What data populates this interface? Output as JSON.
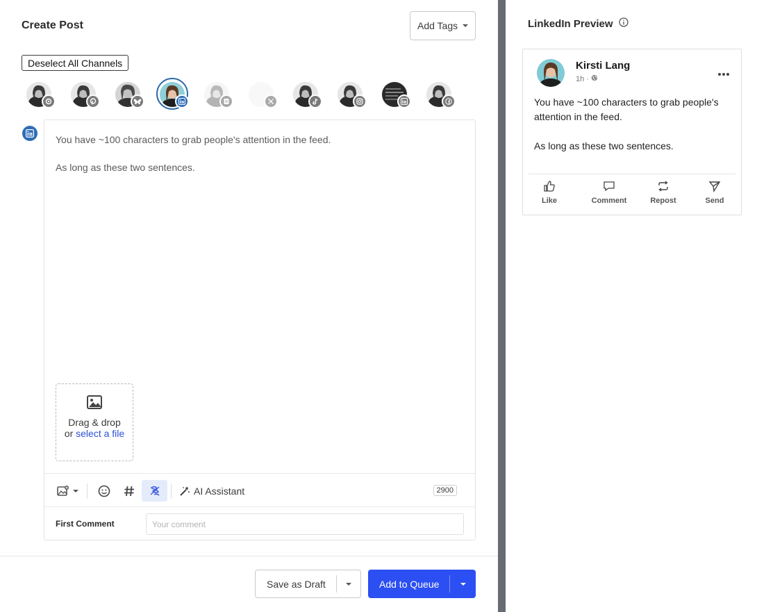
{
  "composer": {
    "title": "Create Post",
    "add_tags_label": "Add Tags",
    "deselect_label": "Deselect All Channels",
    "channels": [
      {
        "network": "threads",
        "icon": "threads-icon",
        "state": "normal"
      },
      {
        "network": "pinterest",
        "icon": "pinterest-icon",
        "state": "normal"
      },
      {
        "network": "bluesky",
        "icon": "butterfly-icon",
        "state": "normal"
      },
      {
        "network": "linkedin",
        "icon": "linkedin-icon",
        "state": "selected"
      },
      {
        "network": "startpage",
        "icon": "page-icon",
        "state": "faded"
      },
      {
        "network": "x",
        "icon": "x-icon",
        "state": "faded"
      },
      {
        "network": "tiktok",
        "icon": "tiktok-icon",
        "state": "normal"
      },
      {
        "network": "instagram",
        "icon": "instagram-icon",
        "state": "normal"
      },
      {
        "network": "linkedin-page",
        "icon": "linkedin-icon",
        "state": "normal"
      },
      {
        "network": "facebook",
        "icon": "facebook-icon",
        "state": "normal"
      }
    ],
    "post_lines": [
      "You have ~100 characters to grab people's attention in the feed.",
      "As long as these two sentences."
    ],
    "dropzone": {
      "line1": "Drag & drop",
      "line2_prefix": "or ",
      "link": "select a file"
    },
    "toolbar": {
      "ai_label": "AI Assistant",
      "char_count": "2900"
    },
    "first_comment": {
      "label": "First Comment",
      "placeholder": "Your comment"
    },
    "save_draft_label": "Save as Draft",
    "add_queue_label": "Add to Queue",
    "colors": {
      "accent": "#2b4ff2",
      "linkedin": "#2f6db5",
      "divider": "#676b73"
    }
  },
  "preview": {
    "title": "LinkedIn Preview",
    "author": "Kirsti Lang",
    "time": "1h ·",
    "body_lines": [
      "You have ~100 characters to grab people's attention in the feed.",
      "As long as these two sentences."
    ],
    "actions": [
      "Like",
      "Comment",
      "Repost",
      "Send"
    ]
  }
}
